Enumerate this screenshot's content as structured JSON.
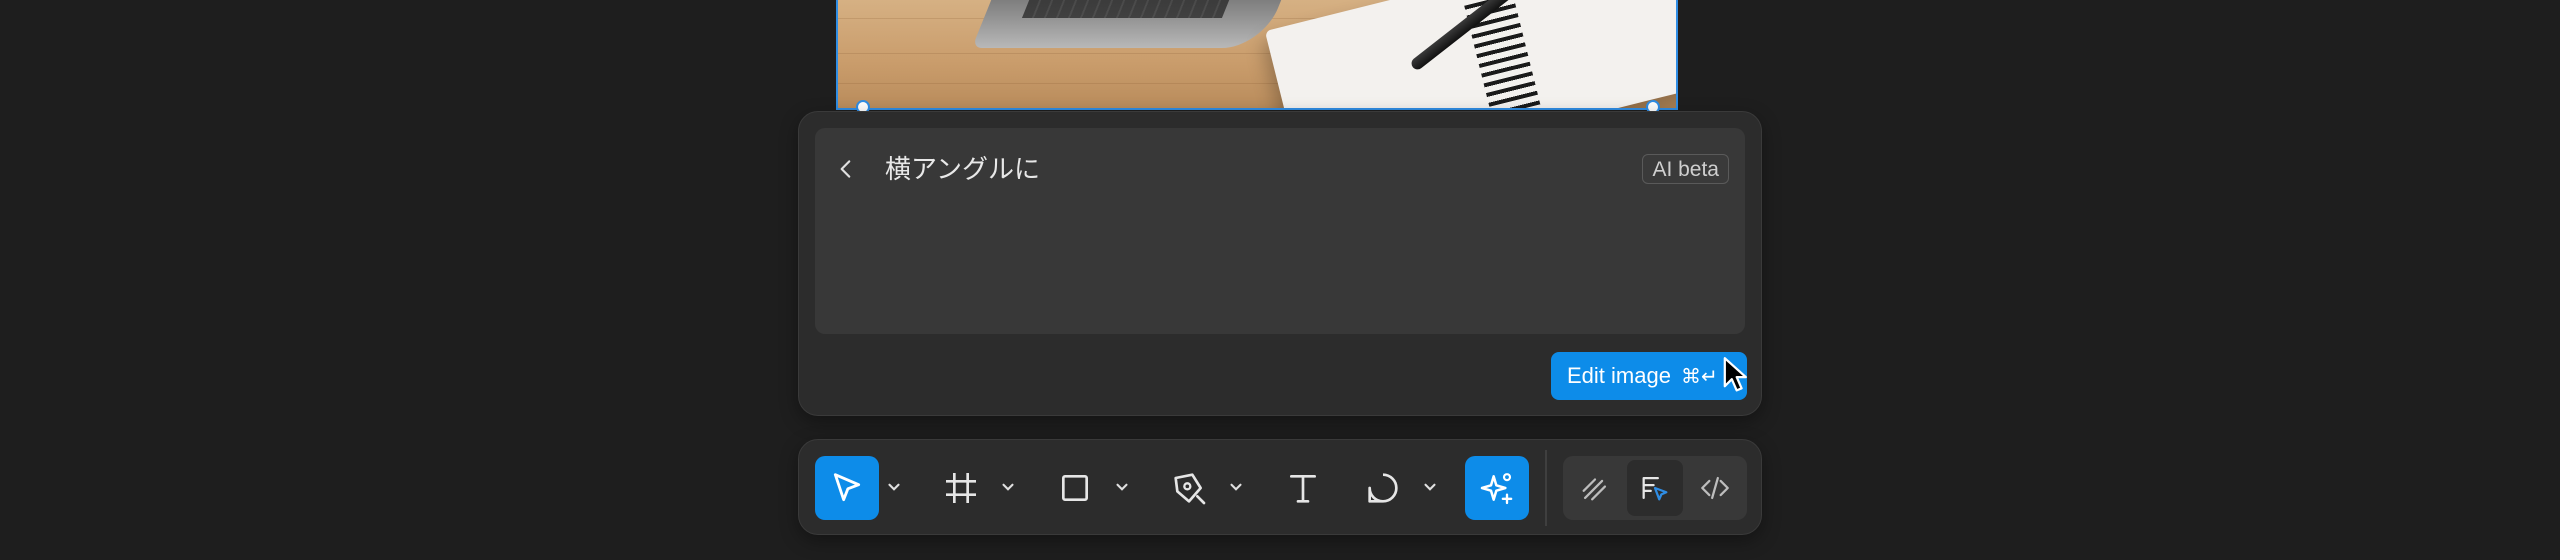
{
  "prompt_panel": {
    "prompt_text": "横アングルに",
    "badge": "AI beta",
    "edit_button": {
      "label": "Edit image",
      "shortcut": "⌘↵"
    }
  },
  "colors": {
    "accent": "#0d8ce9",
    "panel_bg": "#2c2c2c",
    "input_bg": "#383838",
    "canvas_bg": "#1e1e1e",
    "selection": "#2f8de4"
  },
  "toolbar": {
    "tools": [
      {
        "icon": "move-cursor-icon",
        "active": true,
        "has_dropdown": true
      },
      {
        "icon": "frame-hash-icon",
        "active": false,
        "has_dropdown": true
      },
      {
        "icon": "rectangle-icon",
        "active": false,
        "has_dropdown": true
      },
      {
        "icon": "pen-icon",
        "active": false,
        "has_dropdown": true
      },
      {
        "icon": "text-icon",
        "active": false,
        "has_dropdown": false
      },
      {
        "icon": "comment-icon",
        "active": false,
        "has_dropdown": true
      },
      {
        "icon": "ai-sparkle-icon",
        "active": true,
        "has_dropdown": false
      }
    ],
    "modes": [
      {
        "icon": "draw-mode-icon",
        "selected": false
      },
      {
        "icon": "design-mode-icon",
        "selected": true
      },
      {
        "icon": "dev-mode-code-icon",
        "selected": false
      }
    ]
  }
}
